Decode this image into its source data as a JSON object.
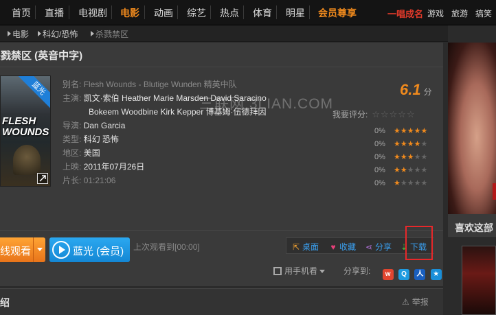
{
  "nav": {
    "items": [
      "首页",
      "直播",
      "电视剧",
      "电影",
      "动画",
      "综艺",
      "热点",
      "体育",
      "明星"
    ],
    "vip": "会员尊享",
    "promo": "一唱成名",
    "extra": [
      "游戏",
      "旅游",
      "搞笑"
    ]
  },
  "breadcrumb": [
    "电影",
    "科幻/恐怖",
    "杀戮禁区"
  ],
  "movie": {
    "title": "杀戮禁区 (英音中字)",
    "poster_badge": "蓝光",
    "poster_title": "FLESH WOUNDS",
    "alias_label": "别名:",
    "alias": "Flesh Wounds - Blutige Wunden 精英中队",
    "cast_label": "主演:",
    "cast_line1": "凯文·索伯 Heather Marie Marsden David Saracino",
    "cast_line2": "Bokeem Woodbine Kirk Kepper 博基姆·伍德拜因",
    "director_label": "导演:",
    "director": "Dan Garcia",
    "genre_label": "类型:",
    "genre": "科幻 恐怖",
    "region_label": "地区:",
    "region": "美国",
    "release_label": "上映:",
    "release": "2011年07月26日",
    "duration_label": "片长:",
    "duration": "01:21:06"
  },
  "watermark": "三联网 3LIAN.COM",
  "rating": {
    "score": "6.1",
    "unit": "分",
    "my_rating_label": "我要评分:",
    "distribution": [
      {
        "pct": "0%",
        "stars": 5
      },
      {
        "pct": "0%",
        "stars": 4
      },
      {
        "pct": "0%",
        "stars": 3
      },
      {
        "pct": "0%",
        "stars": 2
      },
      {
        "pct": "0%",
        "stars": 1
      }
    ]
  },
  "player": {
    "play_label": "线观看",
    "bluray_label": "蓝光 (会员)",
    "last_watch": "上次观看到[00:00]"
  },
  "actions": {
    "desktop": "桌面",
    "favorite": "收藏",
    "share": "分享",
    "download": "下载"
  },
  "mobile_label": "用手机看",
  "share_label": "分享到:",
  "bottom": {
    "tab_fragment": "绍",
    "report": "举报"
  },
  "right": {
    "like_title": "喜欢这部"
  },
  "colors": {
    "accent": "#f08a1d",
    "link": "#3aa0f0",
    "highlight": "#e8282a",
    "blue_button": "#1487d4"
  }
}
